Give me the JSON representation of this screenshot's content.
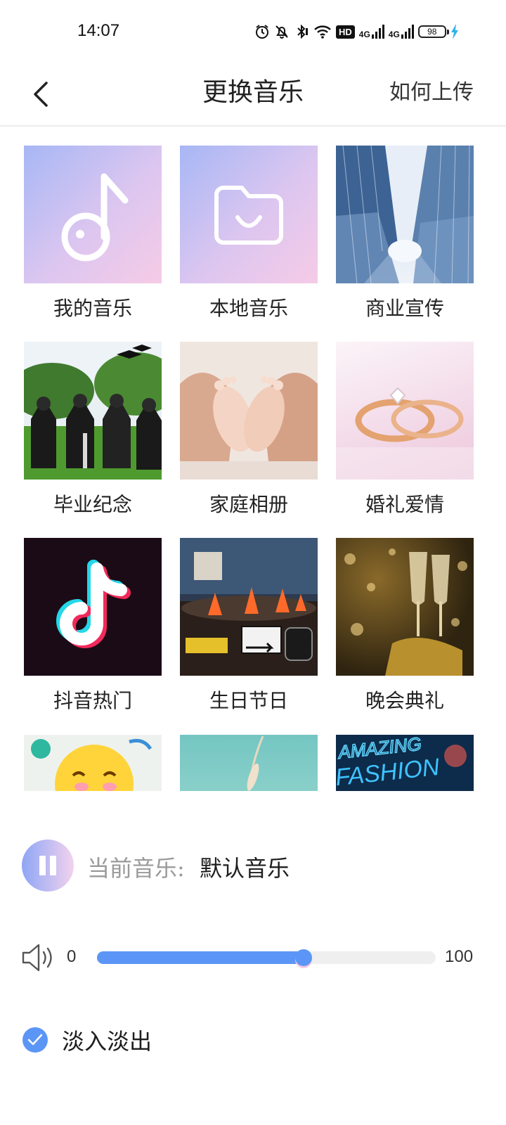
{
  "status_bar": {
    "time": "14:07",
    "net1": "4G",
    "net2": "4G",
    "hd": "HD",
    "battery": "98"
  },
  "header": {
    "title": "更换音乐",
    "upload_link": "如何上传"
  },
  "categories": [
    {
      "label": "我的音乐",
      "icon": "music-note-icon"
    },
    {
      "label": "本地音乐",
      "icon": "folder-icon"
    },
    {
      "label": "商业宣传",
      "icon": "skyscrapers-image"
    },
    {
      "label": "毕业纪念",
      "icon": "graduation-image"
    },
    {
      "label": "家庭相册",
      "icon": "baby-feet-image"
    },
    {
      "label": "婚礼爱情",
      "icon": "wedding-rings-image"
    },
    {
      "label": "抖音热门",
      "icon": "tiktok-logo"
    },
    {
      "label": "生日节日",
      "icon": "birthday-cake-image"
    },
    {
      "label": "晚会典礼",
      "icon": "champagne-image"
    },
    {
      "label": "",
      "icon": "emoji-image"
    },
    {
      "label": "",
      "icon": "reed-grass-image"
    },
    {
      "label": "",
      "icon": "neon-fashion-image"
    }
  ],
  "neon_text": "AMAZING FASHION",
  "player": {
    "current_label": "当前音乐:",
    "current_value": "默认音乐",
    "state": "playing"
  },
  "volume": {
    "min": "0",
    "max": "100",
    "value": 61
  },
  "fade": {
    "label": "淡入淡出",
    "checked": true
  },
  "colors": {
    "accent": "#5b96f6",
    "label_gray": "#9a9a9a"
  }
}
